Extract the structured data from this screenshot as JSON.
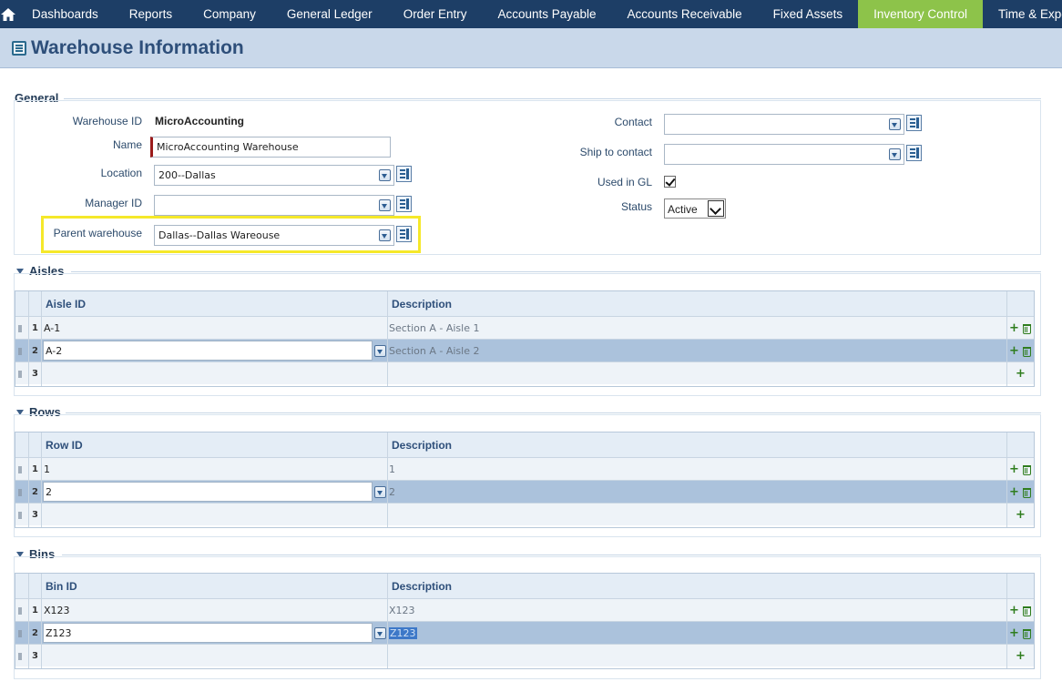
{
  "nav": {
    "items": [
      "Dashboards",
      "Reports",
      "Company",
      "General Ledger",
      "Order Entry",
      "Accounts Payable",
      "Accounts Receivable",
      "Fixed Assets",
      "Inventory Control",
      "Time & Expenses"
    ],
    "active": "Inventory Control",
    "active_color": "#8dc34a",
    "bar_color": "#1d3e66"
  },
  "page": {
    "title": "Warehouse Information",
    "icon": "form-icon"
  },
  "general": {
    "title": "General",
    "warehouse_id_label": "Warehouse ID",
    "warehouse_id": "MicroAccounting",
    "name_label": "Name",
    "name": "MicroAccounting Warehouse",
    "location_label": "Location",
    "location": "200--Dallas",
    "manager_label": "Manager ID",
    "manager": "",
    "parent_label": "Parent warehouse",
    "parent": "Dallas--Dallas Wareouse",
    "contact_label": "Contact",
    "contact": "",
    "ship_label": "Ship to contact",
    "ship": "",
    "used_gl_label": "Used in GL",
    "used_gl": true,
    "status_label": "Status",
    "status": "Active"
  },
  "aisles": {
    "title": "Aisles",
    "col_id": "Aisle ID",
    "col_desc": "Description",
    "rows": [
      {
        "num": "1",
        "id": "A-1",
        "desc": "Section A - Aisle 1"
      },
      {
        "num": "2",
        "id": "A-2",
        "desc": "Section A - Aisle 2"
      },
      {
        "num": "3",
        "id": "",
        "desc": ""
      }
    ]
  },
  "rows": {
    "title": "Rows",
    "col_id": "Row ID",
    "col_desc": "Description",
    "rows": [
      {
        "num": "1",
        "id": "1",
        "desc": "1"
      },
      {
        "num": "2",
        "id": "2",
        "desc": "2"
      },
      {
        "num": "3",
        "id": "",
        "desc": ""
      }
    ]
  },
  "bins": {
    "title": "Bins",
    "col_id": "Bin ID",
    "col_desc": "Description",
    "rows": [
      {
        "num": "1",
        "id": "X123",
        "desc": "X123"
      },
      {
        "num": "2",
        "id": "Z123",
        "desc": "Z123"
      },
      {
        "num": "3",
        "id": "",
        "desc": ""
      }
    ]
  }
}
